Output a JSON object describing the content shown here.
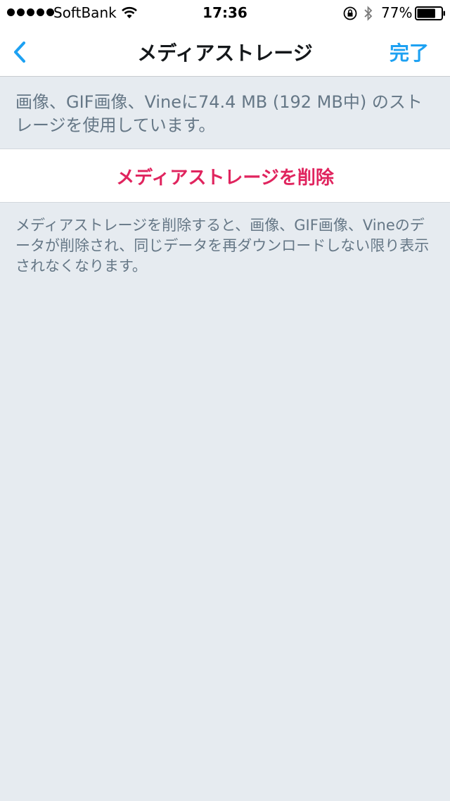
{
  "status_bar": {
    "carrier": "SoftBank",
    "time": "17:36",
    "battery_percent": "77%",
    "battery_level": 0.77,
    "icons": [
      "signal-dots",
      "wifi-icon",
      "rotation-lock-icon",
      "bluetooth-icon",
      "battery-icon"
    ]
  },
  "nav": {
    "title": "メディアストレージ",
    "back_icon": "chevron-left-icon",
    "done_label": "完了"
  },
  "usage": {
    "text": "画像、GIF画像、Vineに74.4 MB (192 MB中) のストレージを使用しています。"
  },
  "actions": {
    "delete_label": "メディアストレージを削除"
  },
  "footer": {
    "description": "メディアストレージを削除すると、画像、GIF画像、Vineのデータが削除され、同じデータを再ダウンロードしない限り表示されなくなります。"
  },
  "colors": {
    "accent": "#1da1f2",
    "destructive": "#e0245e",
    "background": "#e6ebf0",
    "secondary_text": "#657786"
  }
}
